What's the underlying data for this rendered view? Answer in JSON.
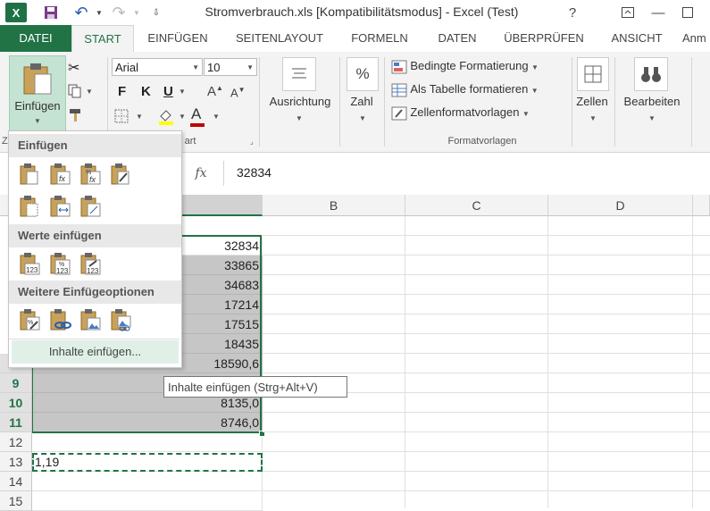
{
  "title_bar": {
    "title": "Stromverbrauch.xls  [Kompatibilitätsmodus] - Excel (Test)",
    "help": "?",
    "app_icon": "excel-icon"
  },
  "tabs": [
    {
      "label": "DATEI"
    },
    {
      "label": "START"
    },
    {
      "label": "EINFÜGEN"
    },
    {
      "label": "SEITENLAYOUT"
    },
    {
      "label": "FORMELN"
    },
    {
      "label": "DATEN"
    },
    {
      "label": "ÜBERPRÜFEN"
    },
    {
      "label": "ANSICHT"
    },
    {
      "label": "Anm"
    }
  ],
  "ribbon": {
    "paste_label": "Einfügen",
    "font_name": "Arial",
    "font_size": "10",
    "bold": "F",
    "italic": "K",
    "underline": "U",
    "alignment_label": "Ausrichtung",
    "number_symbol": "%",
    "number_label": "Zahl",
    "cond_format": "Bedingte Formatierung",
    "as_table": "Als Tabelle formatieren",
    "cell_styles": "Zellenformatvorlagen",
    "styles_group": "Formatvorlagen",
    "cells_label": "Zellen",
    "edit_label": "Bearbeiten",
    "font_group_tail": "art",
    "font_color": "#c00000",
    "fill_color": "#ffff00"
  },
  "formula_bar": {
    "fx": "fx",
    "value": "32834"
  },
  "columns": [
    "B",
    "C",
    "D"
  ],
  "rows": [
    {
      "num": "8",
      "a": "18590,6"
    },
    {
      "num": "9",
      "a": ""
    },
    {
      "num": "10",
      "a": "8135,0"
    },
    {
      "num": "11",
      "a": "8746,0"
    },
    {
      "num": "12",
      "a": ""
    },
    {
      "num": "13",
      "a": "1,19"
    },
    {
      "num": "14",
      "a": ""
    },
    {
      "num": "15",
      "a": ""
    }
  ],
  "column_a_values": [
    "32834",
    "33865",
    "34683",
    "17214",
    "17515",
    "18435"
  ],
  "paste_menu": {
    "section1": "Einfügen",
    "section2": "Werte einfügen",
    "section3": "Weitere Einfügeoptionen",
    "special": "Inhalte einfügen..."
  },
  "tooltip": "Inhalte einfügen (Strg+Alt+V)",
  "accent": "#217346"
}
